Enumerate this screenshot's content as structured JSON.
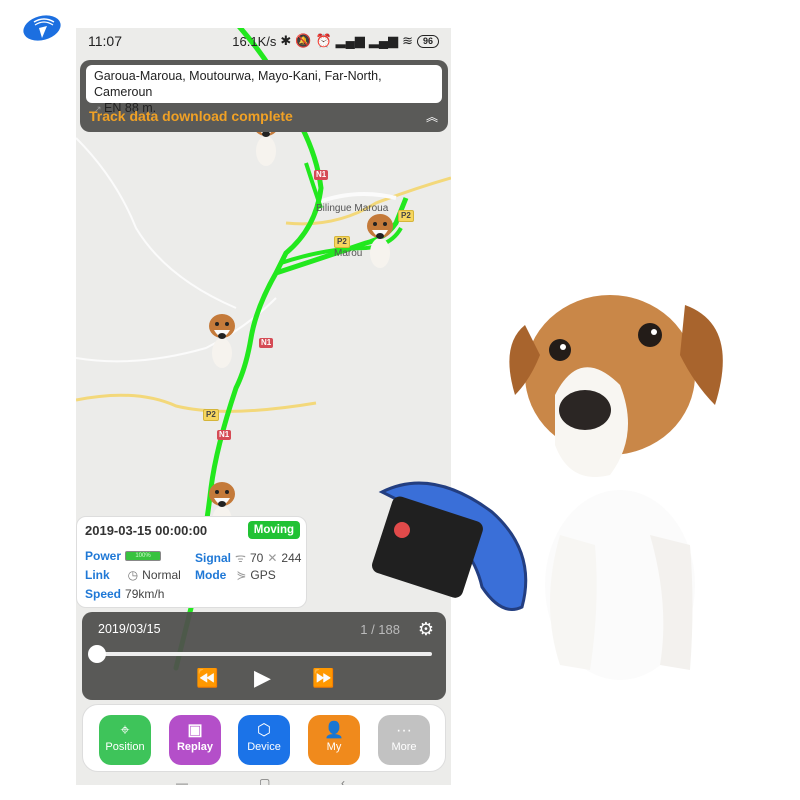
{
  "status_bar": {
    "time": "11:07",
    "network_speed": "16.1K/s",
    "icons": [
      "bluetooth-icon",
      "mute-icon",
      "alarm-icon",
      "signal-icon",
      "signal-icon",
      "wifi-icon"
    ],
    "battery": "96"
  },
  "address_panel": {
    "address": "Garoua-Maroua, Moutourwa, Mayo-Kani, Far-North, Cameroun",
    "direction": "EN 88 m.",
    "download_status": "Track data download complete",
    "collapse_icon": "double-chevron-up-icon"
  },
  "map": {
    "labels": [
      "Bilingue Maroua",
      "Marou"
    ],
    "road_badges": [
      "P2",
      "P2",
      "N1",
      "N1",
      "P2",
      "N1"
    ],
    "track_color": "#22e81e"
  },
  "info_card": {
    "timestamp": "2019-03-15 00:00:00",
    "status_badge": "Moving",
    "power_label": "Power",
    "power_value": "100%",
    "signal_label": "Signal",
    "signal_value": "70",
    "satellite_value": "244",
    "link_label": "Link",
    "link_value": "Normal",
    "mode_label": "Mode",
    "mode_value": "GPS",
    "speed_label": "Speed",
    "speed_value": "79km/h"
  },
  "player": {
    "date": "2019/03/15",
    "position": "1 / 188",
    "progress_fraction": 0.0,
    "buttons": [
      "rewind",
      "play",
      "fast-forward"
    ]
  },
  "bottom_nav": {
    "items": [
      {
        "label": "Position",
        "icon": "location-pin-icon",
        "color": "#3ec45a"
      },
      {
        "label": "Replay",
        "icon": "video-camera-icon",
        "color": "#b44fc9"
      },
      {
        "label": "Device",
        "icon": "cube-icon",
        "color": "#1b73e8"
      },
      {
        "label": "My",
        "icon": "user-icon",
        "color": "#f08a1c"
      },
      {
        "label": "More",
        "icon": "more-dots-icon",
        "color": "#c2c2c2"
      }
    ]
  }
}
